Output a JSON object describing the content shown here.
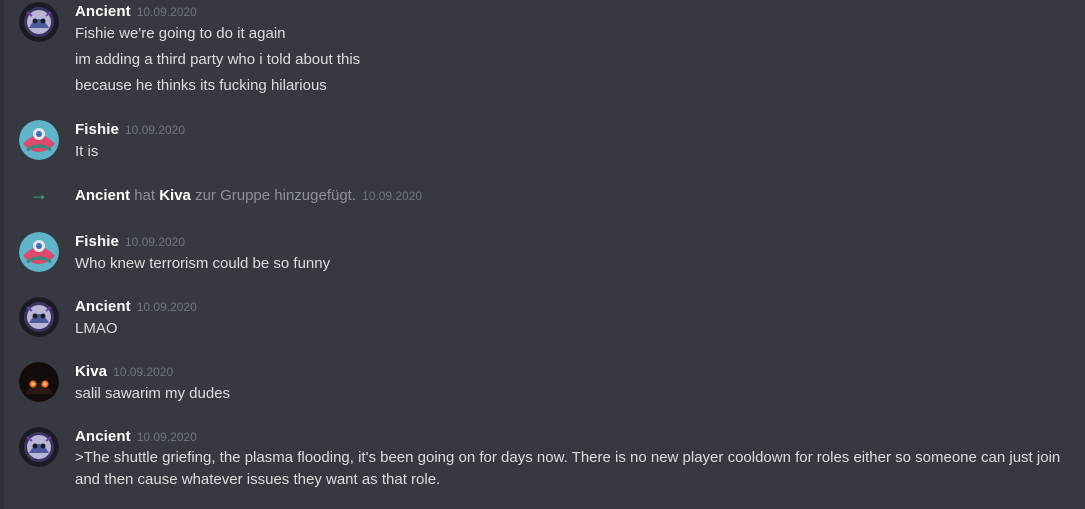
{
  "colors": {
    "background": "#36393f",
    "username": "#ffffff",
    "timestamp": "#72767d",
    "message_text": "#dcddde",
    "system_text": "#8e9297",
    "join_arrow": "#43b581"
  },
  "messages": [
    {
      "author": "Ancient",
      "timestamp": "10.09.2020",
      "avatar": "ancient-avatar",
      "lines": [
        "Fishie we're going to do it again",
        "im adding a third party who i told about this",
        "because he thinks its fucking hilarious"
      ]
    },
    {
      "author": "Fishie",
      "timestamp": "10.09.2020",
      "avatar": "fishie-avatar",
      "lines": [
        "It is"
      ]
    },
    {
      "author": "Fishie",
      "timestamp": "10.09.2020",
      "avatar": "fishie-avatar",
      "lines": [
        "Who knew terrorism could be so funny"
      ]
    },
    {
      "author": "Ancient",
      "timestamp": "10.09.2020",
      "avatar": "ancient-avatar",
      "lines": [
        "LMAO"
      ]
    },
    {
      "author": "Kiva",
      "timestamp": "10.09.2020",
      "avatar": "kiva-avatar",
      "lines": [
        "salil sawarim my dudes"
      ]
    },
    {
      "author": "Ancient",
      "timestamp": "10.09.2020",
      "avatar": "ancient-avatar",
      "lines": [
        ">The shuttle griefing, the plasma flooding, it's been going on for days now. There is no new player cooldown for roles either so someone can just join and then cause whatever issues they want as that role."
      ]
    }
  ],
  "system_message": {
    "icon": "arrow-right-icon",
    "actor": "Ancient",
    "word_hat": "hat",
    "target": "Kiva",
    "action": "zur Gruppe hinzugefügt.",
    "timestamp": "10.09.2020"
  }
}
